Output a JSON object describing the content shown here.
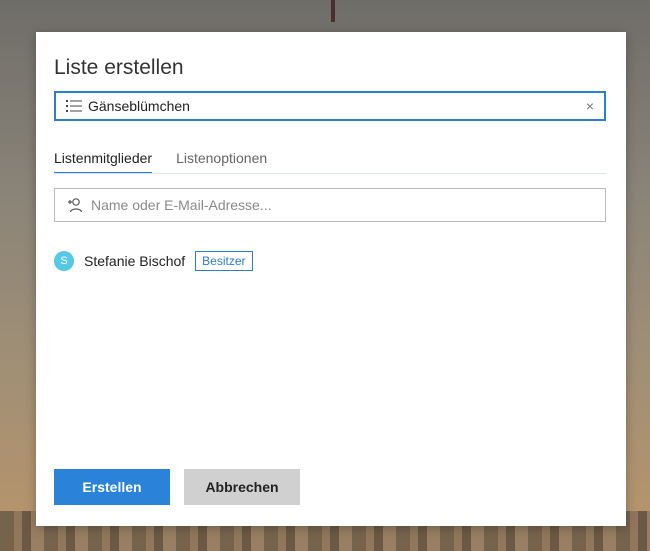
{
  "dialog": {
    "title": "Liste erstellen",
    "list_name_value": "Gänseblümchen",
    "list_icon": "list-icon",
    "clear_icon": "×",
    "tabs": [
      {
        "label": "Listenmitglieder",
        "active": true
      },
      {
        "label": "Listenoptionen",
        "active": false
      }
    ],
    "member_search": {
      "icon": "add-person-icon",
      "placeholder": "Name oder E-Mail-Adresse..."
    },
    "members": [
      {
        "initial": "S",
        "name": "Stefanie Bischof",
        "role": "Besitzer"
      }
    ],
    "buttons": {
      "create_label": "Erstellen",
      "cancel_label": "Abbrechen"
    }
  },
  "colors": {
    "accent": "#2b7cd3",
    "avatar": "#55c8e8",
    "cancel_button": "#d0d0d0"
  }
}
